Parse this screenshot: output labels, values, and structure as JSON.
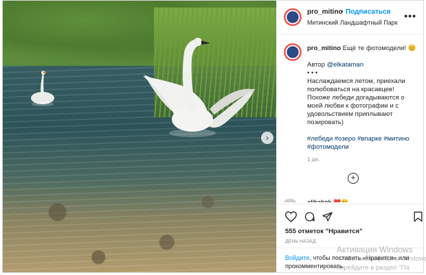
{
  "post": {
    "username": "pro_mitino",
    "dot": "•",
    "follow_label": "Подписаться",
    "location": "Митинский Ландшафтный Парк",
    "more_label": "•••",
    "caption": {
      "username": "pro_mitino",
      "text": "Ещё те фотомодели!",
      "emoji": "😊",
      "author_prefix": "Автор",
      "author_handle": "@elkataman",
      "dots": "• • •",
      "body": "Наслаждаемся летом, приехали полюбоваться на красавцев! Похоже лебеди догадываются о моей любви к фотографии и с удовольствием приплывают позировать)",
      "hashtags": "#лебеди #озеро #впарке #митино #фотомодели",
      "time": "1 дн."
    },
    "load_more_label": "+",
    "next_comment_username": "alikakok",
    "next_comment_emoji": "❤️😊",
    "likes": "555 отметок \"Нравится\"",
    "posted_ago": "ДЕНЬ НАЗАД",
    "login_link": "Войдите",
    "login_text": ", чтобы поставить «Нравится» или прокомментировать."
  },
  "icons": {
    "like": "heart-icon",
    "comment": "comment-icon",
    "share": "share-icon",
    "save": "bookmark-icon",
    "next": "chevron-right-icon"
  },
  "watermark": {
    "line1": "Активация Windows",
    "line2": "Чтобы активировать Windows,",
    "line3": "перейдите в раздел \"Па"
  },
  "colors": {
    "accent": "#0095f6",
    "link": "#00376b",
    "muted": "#8e8e8e"
  }
}
